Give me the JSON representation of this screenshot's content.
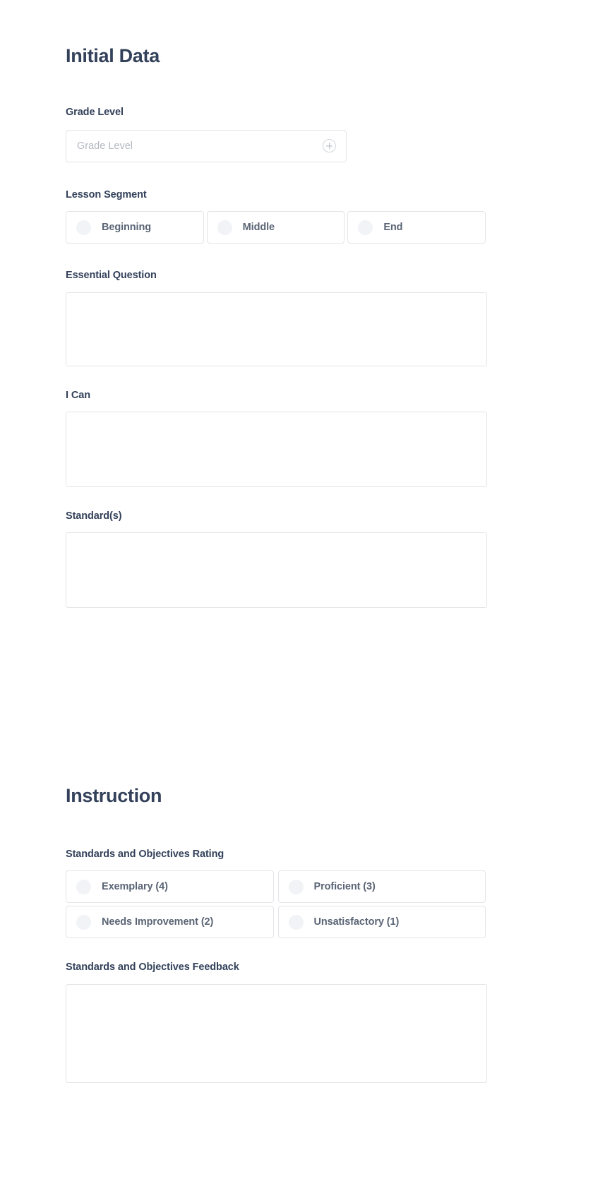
{
  "sections": [
    {
      "id": "initial-data",
      "title": "Initial Data"
    },
    {
      "id": "instruction",
      "title": "Instruction"
    }
  ],
  "initial_data": {
    "title": "Initial Data",
    "grade_level": {
      "label": "Grade Level",
      "placeholder": "Grade Level",
      "value": "",
      "add_icon": "plus-circle-icon"
    },
    "lesson_segment": {
      "label": "Lesson Segment",
      "options": [
        {
          "label": "Beginning",
          "selected": false
        },
        {
          "label": "Middle",
          "selected": false
        },
        {
          "label": "End",
          "selected": false
        }
      ]
    },
    "essential_question": {
      "label": "Essential Question",
      "value": "",
      "placeholder": ""
    },
    "i_can": {
      "label": "I Can",
      "value": "",
      "placeholder": ""
    },
    "standards": {
      "label": "Standard(s)",
      "value": "",
      "placeholder": ""
    }
  },
  "instruction": {
    "title": "Instruction",
    "standards_objectives_rating": {
      "label": "Standards and Objectives Rating",
      "options": [
        {
          "label": "Exemplary (4)",
          "selected": false
        },
        {
          "label": "Proficient (3)",
          "selected": false
        },
        {
          "label": "Needs Improvement (2)",
          "selected": false
        },
        {
          "label": "Unsatisfactory (1)",
          "selected": false
        }
      ]
    },
    "standards_objectives_feedback": {
      "label": "Standards and Objectives Feedback",
      "value": "",
      "placeholder": ""
    }
  },
  "colors": {
    "heading": "#33415a",
    "label": "#33415a",
    "option_text": "#5b6575",
    "border": "#e3e5e8",
    "radio_fill": "#f1f3f6",
    "placeholder": "#b3b8c0",
    "background": "#ffffff"
  }
}
